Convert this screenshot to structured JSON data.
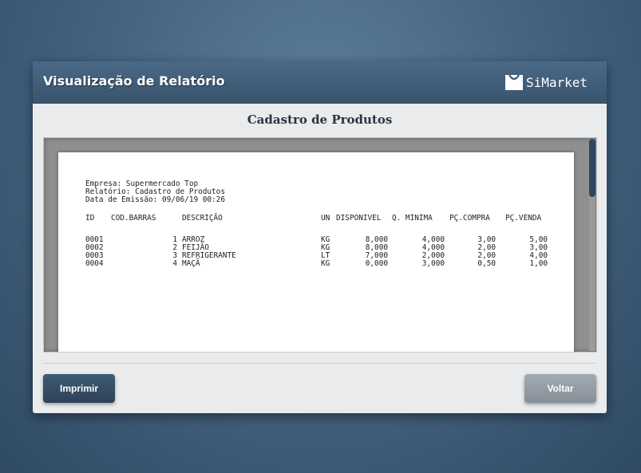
{
  "window": {
    "title": "Visualização de Relatório",
    "brand": "SiMarket"
  },
  "report": {
    "heading": "Cadastro de Produtos",
    "company": "Empresa: Supermercado Top",
    "report_name": "Relatório: Cadastro de Produtos",
    "emission": "Data de Emissão: 09/06/19 00:26",
    "columns": {
      "id": "ID",
      "barcode": "COD.BARRAS",
      "description": "DESCRIÇÃO",
      "unit": "UN",
      "available": "DISPONIVEL",
      "min_qty": "Q. MINIMA",
      "buy_price": "PÇ.COMPRA",
      "sell_price": "PÇ.VENDA"
    },
    "rows": [
      {
        "id": "0001",
        "barcode": "1",
        "description": "ARROZ",
        "unit": "KG",
        "available": "8,000",
        "min_qty": "4,000",
        "buy_price": "3,00",
        "sell_price": "5,00"
      },
      {
        "id": "0002",
        "barcode": "2",
        "description": "FEIJÃO",
        "unit": "KG",
        "available": "8,000",
        "min_qty": "4,000",
        "buy_price": "2,00",
        "sell_price": "3,00"
      },
      {
        "id": "0003",
        "barcode": "3",
        "description": "REFRIGERANTE",
        "unit": "LT",
        "available": "7,000",
        "min_qty": "2,000",
        "buy_price": "2,00",
        "sell_price": "4,00"
      },
      {
        "id": "0004",
        "barcode": "4",
        "description": "MAÇÃ",
        "unit": "KG",
        "available": "0,000",
        "min_qty": "3,000",
        "buy_price": "0,50",
        "sell_price": "1,00"
      }
    ]
  },
  "buttons": {
    "print": "Imprimir",
    "back": "Voltar"
  },
  "colors": {
    "titlebar": "#3e5a76",
    "print_button": "#34506a",
    "back_button": "#959ea5",
    "scroll_thumb": "#2e4760"
  }
}
